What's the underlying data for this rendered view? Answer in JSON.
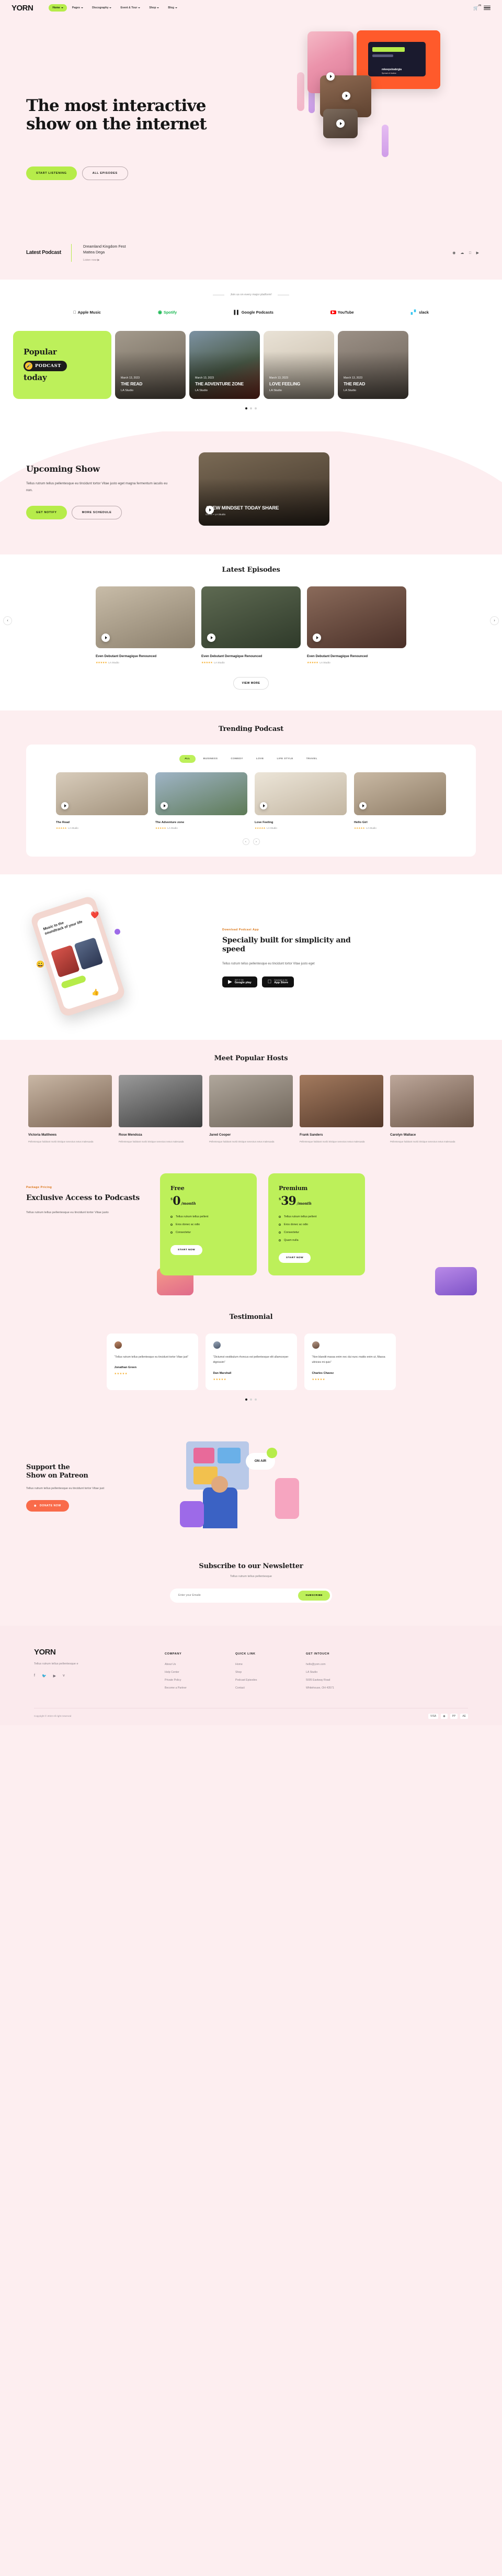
{
  "brand": {
    "name": "YORN"
  },
  "nav": {
    "items": [
      {
        "label": "Home",
        "caret": true,
        "active": true
      },
      {
        "label": "Pages",
        "caret": true,
        "active": false
      },
      {
        "label": "Discography",
        "caret": true,
        "active": false
      },
      {
        "label": "Event & Tour",
        "caret": true,
        "active": false
      },
      {
        "label": "Shop",
        "caret": true,
        "active": false
      },
      {
        "label": "Blog",
        "caret": true,
        "active": false
      }
    ],
    "cart_icon": "cart-icon",
    "cart_count": "(0)",
    "menu_icon": "hamburger-menu-icon"
  },
  "hero": {
    "heading": "The most interactive show on the internet",
    "primary_button": "START LISTENING",
    "secondary_button": "ALL EPISODES",
    "card_label": "mkeepsloabrgia",
    "card_sub": "Spread of Justice"
  },
  "latest": {
    "title": "Latest Podcast",
    "episode": "Dreamland Kingdom Fest",
    "artist": "Mattea Dega",
    "listen": "Listen now",
    "icons": [
      "spotify-icon",
      "soundcloud-icon",
      "apple-icon",
      "youtube-icon"
    ]
  },
  "platforms": {
    "label": "Join us on every major platform!",
    "items": [
      {
        "name": "Apple Music",
        "icon": "apple-icon"
      },
      {
        "name": "Spotify",
        "icon": "spotify-icon"
      },
      {
        "name": "Google Podcasts",
        "icon": "google-podcasts-icon"
      },
      {
        "name": "YouTube",
        "icon": "youtube-icon"
      },
      {
        "name": "slack",
        "icon": "slack-icon"
      }
    ]
  },
  "popular": {
    "title_line1": "Popular",
    "badge": "PODCAST",
    "title_line2": "today",
    "cards": [
      {
        "date": "March 13, 2023",
        "name": "THE READ",
        "studio": "LA Studio"
      },
      {
        "date": "March 13, 2023",
        "name": "THE ADVENTURE ZONE",
        "studio": "LA Studio"
      },
      {
        "date": "March 13, 2023",
        "name": "LOVE FEELING",
        "studio": "LA Studio"
      },
      {
        "date": "March 13, 2023",
        "name": "THE READ",
        "studio": "LA Studio"
      }
    ]
  },
  "upcoming": {
    "title": "Upcoming Show",
    "body": "Tellus rutrum tellus pellentesque eu tincidunt tortor Vitae justo eget magna fermentum iaculis eu non.",
    "btn_primary": "GET NOTIFY",
    "btn_secondary": "MORE SCHEDULE",
    "video_title": "ANEW MINDSET TODAY SHARE",
    "video_sub": "Genre • LA Studio"
  },
  "episodes": {
    "title": "Latest Episodes",
    "view_more": "VIEW MORE",
    "items": [
      {
        "title": "Even Debutant Dermagique Renounced",
        "stars": "★★★★★",
        "studio": "LA Studio"
      },
      {
        "title": "Even Debutant Dermagique Renounced",
        "stars": "★★★★★",
        "studio": "LA Studio"
      },
      {
        "title": "Even Debutant Dermagique Renounced",
        "stars": "★★★★★",
        "studio": "LA Studio"
      }
    ]
  },
  "trending": {
    "title": "Trending Podcast",
    "tabs": [
      "ALL",
      "BUSINESS",
      "COMEDY",
      "LOVE",
      "LIFE STYLE",
      "TRAVEL"
    ],
    "active_tab": "ALL",
    "items": [
      {
        "title": "The Read",
        "stars": "★★★★★",
        "studio": "LA Studio"
      },
      {
        "title": "The Adventure zone",
        "stars": "★★★★★",
        "studio": "LA Studio"
      },
      {
        "title": "Love Feeling",
        "stars": "★★★★★",
        "studio": "LA Studio"
      },
      {
        "title": "Hello Girl",
        "stars": "★★★★★",
        "studio": "LA Studio"
      }
    ]
  },
  "promo": {
    "kicker": "Download Podcast App",
    "title": "Specially built for simplicity and speed",
    "body": "Tellus rutrum tellus pellentesque eu tincidunt tortor Vitae justo eget",
    "phone_headline": "Music to the soundtrack of your life",
    "stores": [
      {
        "small": "GET IT ON",
        "big": "Google play",
        "icon": "google-play-icon"
      },
      {
        "small": "Download on the",
        "big": "App Store",
        "icon": "apple-icon"
      }
    ]
  },
  "hosts": {
    "title": "Meet Popular Hosts",
    "items": [
      {
        "name": "Victoria Matthews",
        "desc": "Pellentesque habitant morbi tristique senectus netus malesuada"
      },
      {
        "name": "Rose Mendoza",
        "desc": "Pellentesque habitant morbi tristique senectus netus malesuada"
      },
      {
        "name": "Jared Cooper",
        "desc": "Pellentesque habitant morbi tristique senectus netus malesuada"
      },
      {
        "name": "Frank Sanders",
        "desc": "Pellentesque habitant morbi tristique senectus netus malesuada"
      },
      {
        "name": "Carolyn Wallace",
        "desc": "Pellentesque habitant morbi tristique senectus netus malesuada"
      }
    ]
  },
  "pricing": {
    "kicker": "Package Pricing",
    "title": "Exclusive Access to Podcasts",
    "body": "Tellus rutrum tellus pellentesque eu tincidunt tortor Vitae justo",
    "plans": [
      {
        "name": "Free",
        "currency": "$",
        "amount": "0",
        "period": "/month",
        "features": [
          "Tellus rutrum tellus pellent",
          "Eros donec ac odio",
          "Consectetur"
        ],
        "button": "START NOW"
      },
      {
        "name": "Premium",
        "currency": "$",
        "amount": "39",
        "period": "/month",
        "features": [
          "Tellus rutrum tellus pellent",
          "Eros donec ac odio",
          "Consectetur",
          "Quam nulla"
        ],
        "button": "START NOW"
      }
    ]
  },
  "testimonial": {
    "title": "Testimonial",
    "items": [
      {
        "text": "“Tellus rutrum tellus pellentesque eu tincidunt tortor Vitae just”",
        "name": "Jonathan Green",
        "stars": "★★★★★"
      },
      {
        "text": "“Dictumst vestibulum rhoncus est pellentesque elit ullamcorper dignissim”",
        "name": "Dan Marshall",
        "stars": "★★★★★"
      },
      {
        "text": "“Non blandit massa enim nec dui nunc mattis enim ut, Massa ultricies mi quis”",
        "name": "Charles Chavez",
        "stars": "★★★★★"
      }
    ]
  },
  "patreon": {
    "title_line1": "Support the",
    "title_line2": "Show on Patreon",
    "body": "Tellus rutrum tellus pellentesque eu tincidunt tortor Vitae just",
    "button": "DONATE NOW",
    "onair_badge": "ON AIR"
  },
  "newsletter": {
    "title": "Subscribe to our Newsletter",
    "subtitle": "Tellus rutrum tellus pellentesque",
    "placeholder": "Enter your Emaile",
    "button": "SUBSCRIBE"
  },
  "footer": {
    "logo": "YORN",
    "tagline": "Tellus rutrum tellus pellentesque e",
    "social": [
      "facebook-icon",
      "twitter-icon",
      "youtube-icon",
      "vimeo-icon"
    ],
    "columns": [
      {
        "heading": "COMPANY",
        "links": [
          "About Us",
          "Help Center",
          "Private Policy",
          "Become a Partner"
        ]
      },
      {
        "heading": "QUICK LINK",
        "links": [
          "Home",
          "Shop",
          "Podcast Episodes",
          "Contact"
        ]
      },
      {
        "heading": "GET INTOUCH",
        "links": [
          "hello@yorn.com",
          "LA Studio",
          "5005 Eastway Road",
          "Whitehouse, OH 43571"
        ]
      }
    ],
    "copyright": "Copyright © 2023 All right reserved",
    "payments": [
      "visa-icon",
      "mastercard-icon",
      "paypal-icon",
      "amex-icon"
    ]
  }
}
